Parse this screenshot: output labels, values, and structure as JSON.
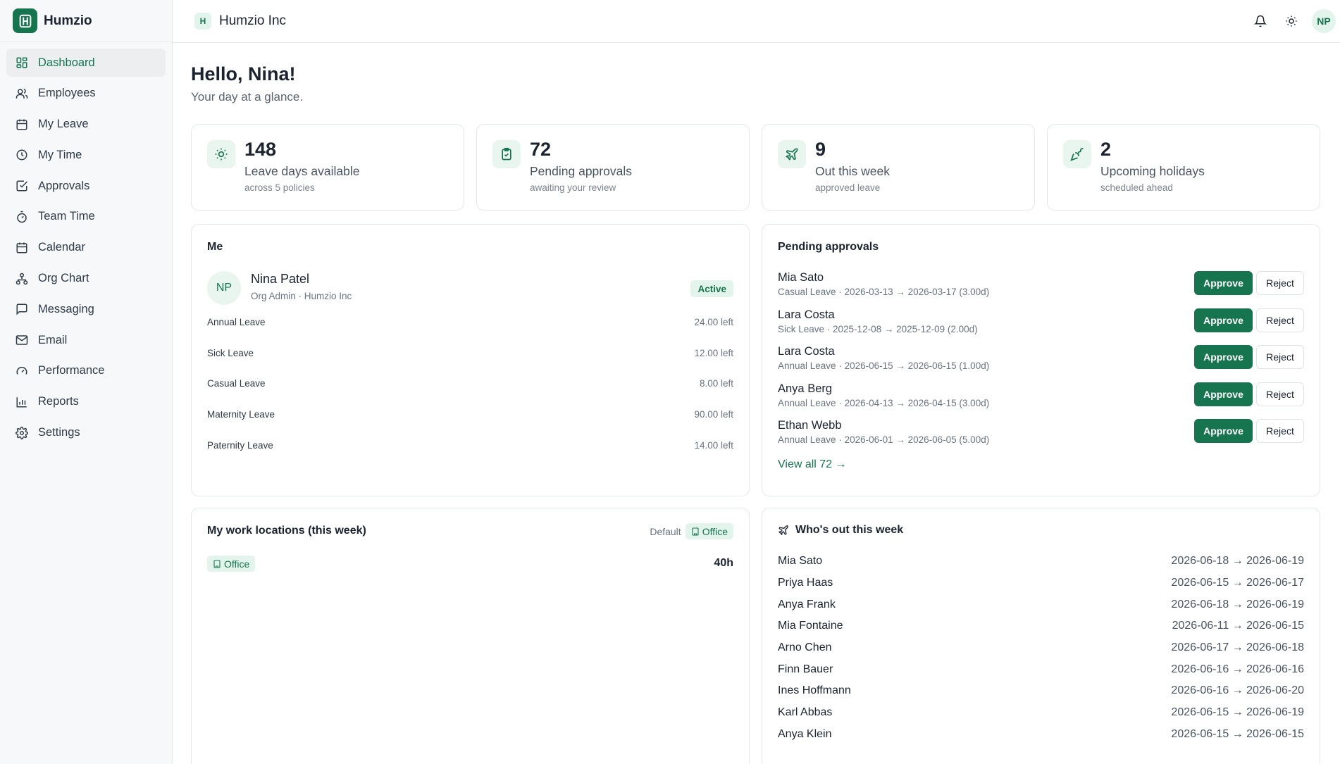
{
  "brand": {
    "name": "Humzio"
  },
  "topbar": {
    "org_initial": "H",
    "org_name": "Humzio Inc",
    "user_initials": "NP"
  },
  "sidebar": {
    "items": [
      {
        "label": "Dashboard",
        "icon": "dashboard-icon",
        "active": true
      },
      {
        "label": "Employees",
        "icon": "users-icon"
      },
      {
        "label": "My Leave",
        "icon": "calendar-icon"
      },
      {
        "label": "My Time",
        "icon": "clock-icon"
      },
      {
        "label": "Approvals",
        "icon": "check-square-icon"
      },
      {
        "label": "Team Time",
        "icon": "timer-icon"
      },
      {
        "label": "Calendar",
        "icon": "calendar-days-icon"
      },
      {
        "label": "Org Chart",
        "icon": "org-chart-icon"
      },
      {
        "label": "Messaging",
        "icon": "message-icon"
      },
      {
        "label": "Email",
        "icon": "mail-icon"
      },
      {
        "label": "Performance",
        "icon": "gauge-icon"
      },
      {
        "label": "Reports",
        "icon": "bar-chart-icon"
      },
      {
        "label": "Settings",
        "icon": "gear-icon"
      }
    ]
  },
  "main": {
    "greeting": "Hello, Nina!",
    "subtitle": "Your day at a glance."
  },
  "stats": [
    {
      "value": "148",
      "label": "Leave days available",
      "sub": "across 5 policies",
      "icon": "sun-icon"
    },
    {
      "value": "72",
      "label": "Pending approvals",
      "sub": "awaiting your review",
      "icon": "clipboard-check-icon"
    },
    {
      "value": "9",
      "label": "Out this week",
      "sub": "approved leave",
      "icon": "plane-icon"
    },
    {
      "value": "2",
      "label": "Upcoming holidays",
      "sub": "scheduled ahead",
      "icon": "party-popper-icon"
    }
  ],
  "me": {
    "title": "Me",
    "initials": "NP",
    "name": "Nina Patel",
    "role": "Org Admin · Humzio Inc",
    "status": "Active",
    "balances": [
      {
        "type": "Annual Leave",
        "left": "24.00 left"
      },
      {
        "type": "Sick Leave",
        "left": "12.00 left"
      },
      {
        "type": "Casual Leave",
        "left": "8.00 left"
      },
      {
        "type": "Maternity Leave",
        "left": "90.00 left"
      },
      {
        "type": "Paternity Leave",
        "left": "14.00 left"
      }
    ]
  },
  "approvals": {
    "title": "Pending approvals",
    "approve_label": "Approve",
    "reject_label": "Reject",
    "view_all": "View all 72 →",
    "items": [
      {
        "name": "Mia Sato",
        "detail": "Casual Leave · 2026-03-13 → 2026-03-17 (3.00d)"
      },
      {
        "name": "Lara Costa",
        "detail": "Sick Leave · 2025-12-08 → 2025-12-09 (2.00d)"
      },
      {
        "name": "Lara Costa",
        "detail": "Annual Leave · 2026-06-15 → 2026-06-15 (1.00d)"
      },
      {
        "name": "Anya Berg",
        "detail": "Annual Leave · 2026-04-13 → 2026-04-15 (3.00d)"
      },
      {
        "name": "Ethan Webb",
        "detail": "Annual Leave · 2026-06-01 → 2026-06-05 (5.00d)"
      }
    ]
  },
  "locations": {
    "title": "My work locations (this week)",
    "default_label": "Default",
    "default_value": "Office",
    "entries": [
      {
        "place": "Office",
        "hours": "40h"
      }
    ]
  },
  "out_this_week": {
    "title": "Who's out this week",
    "items": [
      {
        "name": "Mia Sato",
        "dates": "2026-06-18 → 2026-06-19"
      },
      {
        "name": "Priya Haas",
        "dates": "2026-06-15 → 2026-06-17"
      },
      {
        "name": "Anya Frank",
        "dates": "2026-06-18 → 2026-06-19"
      },
      {
        "name": "Mia Fontaine",
        "dates": "2026-06-11 → 2026-06-15"
      },
      {
        "name": "Arno Chen",
        "dates": "2026-06-17 → 2026-06-18"
      },
      {
        "name": "Finn Bauer",
        "dates": "2026-06-16 → 2026-06-16"
      },
      {
        "name": "Ines Hoffmann",
        "dates": "2026-06-16 → 2026-06-20"
      },
      {
        "name": "Karl Abbas",
        "dates": "2026-06-15 → 2026-06-19"
      },
      {
        "name": "Anya Klein",
        "dates": "2026-06-15 → 2026-06-15"
      }
    ]
  },
  "colors": {
    "accent": "#16744f",
    "accent_soft": "#e3f4ec"
  }
}
